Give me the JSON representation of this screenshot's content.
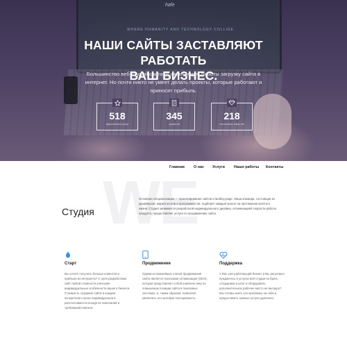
{
  "hero": {
    "laptop_logo": "hafe",
    "laptop_screen_text": "WHERE HUMANITY AND TECHNOLOGY COLLIDE",
    "headline_line1": "НАШИ САЙТЫ ЗАСТАВЛЯЮТ РАБОТАТЬ",
    "headline_line2": "ВАШ БИЗНЕС.",
    "subtitle": "Большинство веб-студий считают окончанием работы загрузку сайта в интернет. Но почти никто не умеет делать проекты, которые работают и приносят прибыль.",
    "stats": [
      {
        "icon": "star-icon",
        "value": "518",
        "label": "выполненных услуг"
      },
      {
        "icon": "document-icon",
        "value": "345",
        "label": "проектов"
      },
      {
        "icon": "diamond-icon",
        "value": "218",
        "label": "постоянных клиентов"
      }
    ]
  },
  "nav": {
    "items": [
      "Главная",
      "О нас",
      "Услуги",
      "Наши работы",
      "Контакты"
    ]
  },
  "studio": {
    "background_word": "WE",
    "title": "Студия",
    "text": "Основная специализация — проектирование сайтов и landing page. Наша команда, состоящая из дизайнеров, маркетологов и программистов, подберёт каждый проект на протяжении всей его жизни. Студия занимается разработкой индивидуального дизайна, оптимизацией скорости работы продукта, предоставляет услуги по продвижению сайта."
  },
  "features": [
    {
      "icon": "bulb-icon",
      "title": "Старт",
      "text": "Вы хотите получать больше клиентов и прибыли из интернета? С нуля разработаем сайт любой сложности учитывая индивидуальные особенности вашего бизнеса. Стоимость создания сайта в каждом конкретном случае индивидуальна и рассчитывается исходя из пожеланий и требований клиента."
    },
    {
      "icon": "mobile-icon",
      "title": "Продвижение",
      "text": "Одним из важнейших этапов продвижения сайта является поисковая оптимизация (SEO), которая представляет собой комплекс мер по повышению позиции сайта в поисковых системах, и, таким образом, позволяет увеличить его целевую посещаемость."
    },
    {
      "icon": "heart-pulse-icon",
      "title": "Поддержка",
      "text": "У Вас уже работающий бизнес и Вы регулярно нуждаетесь в услугах веб-студии но брать сотрудника в штат и оборудовать дополнительное рабочее место не выгодно? Мы готовы взять эти проблемы на себя и предоставить нужные услуги удаленно."
    }
  ],
  "colors": {
    "accent": "#3a8ee6",
    "hero_overlay": "#4d4163",
    "text_dark": "#222222"
  }
}
